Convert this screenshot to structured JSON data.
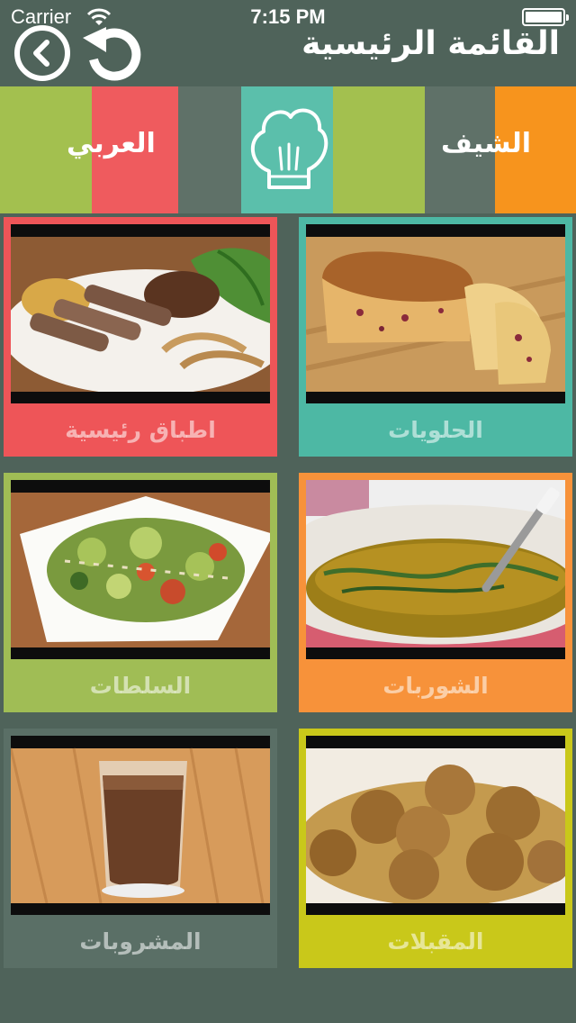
{
  "status_bar": {
    "carrier": "Carrier",
    "time": "7:15 PM"
  },
  "nav": {
    "title": "القائمة الرئيسية",
    "back_icon": "chevron-left-icon",
    "refresh_icon": "refresh-icon"
  },
  "strip": {
    "left_label": "العربي",
    "right_label": "الشيف",
    "logo_icon": "chef-hat-icon",
    "colors": [
      "#a3c04f",
      "#ef5b5e",
      "#5f7168",
      "#5bbfab",
      "#a3c04f",
      "#5f7168",
      "#f7941d"
    ]
  },
  "tiles": [
    {
      "label": "الحلويات",
      "color": "#4db8a4",
      "photo": "cake-loaf"
    },
    {
      "label": "اطباق رئيسية",
      "color": "#ee5558",
      "photo": "steak-plate"
    },
    {
      "label": "الشوربات",
      "color": "#f7923a",
      "photo": "soup-bowl"
    },
    {
      "label": "السلطات",
      "color": "#a0bd55",
      "photo": "salad-plate"
    },
    {
      "label": "المقبلات",
      "color": "#c9c81a",
      "photo": "meatballs"
    },
    {
      "label": "المشروبات",
      "color": "#5a6f66",
      "photo": "smoothie-glass"
    }
  ]
}
